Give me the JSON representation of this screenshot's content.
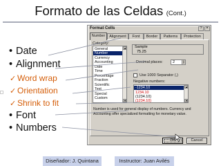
{
  "slide": {
    "title": "Formato de las Celdas",
    "title_cont": "(Cont.)",
    "bullets": [
      "Date",
      "Alignment",
      "Font",
      "Numbers"
    ],
    "bullet_marker": "•",
    "sub_bullets": [
      "Word wrap",
      "Orientation",
      "Shrink to fit"
    ],
    "check_marker": "✓",
    "footer_left": "Diseñador: J. Quintana",
    "footer_right": "Instructor: Juan Avilés",
    "colors": {
      "accent": "#d45d08",
      "footer_bg": "#c8d1ea",
      "callout_line": "#8a8fa0"
    }
  },
  "dialog": {
    "title": "Format Cells",
    "help_icon": "?",
    "close_icon": "×",
    "tabs": [
      "Number",
      "Alignment",
      "Font",
      "Border",
      "Patterns",
      "Protection"
    ],
    "active_tab": "Number",
    "category_label": "Category:",
    "categories": [
      "General",
      "Number",
      "Currency",
      "Accounting",
      "Date",
      "Time",
      "Percentage",
      "Fraction",
      "Scientific",
      "Text",
      "Special",
      "Custom"
    ],
    "selected_category": "Number",
    "sample_label": "Sample",
    "sample_value": "75.25",
    "decimal_label": "Decimal places:",
    "decimal_value": "2",
    "separator_label": "Use 1000 Separator (,)",
    "negative_label": "Negative numbers:",
    "negative_numbers": [
      "-1234.10",
      "1234.10",
      "(1234.10)",
      "(1234.10)"
    ],
    "description": "Number is used for general display of numbers. Currency and Accounting offer specialized formatting for monetary value.",
    "ok_label": "OK",
    "cancel_label": "Cancel"
  }
}
